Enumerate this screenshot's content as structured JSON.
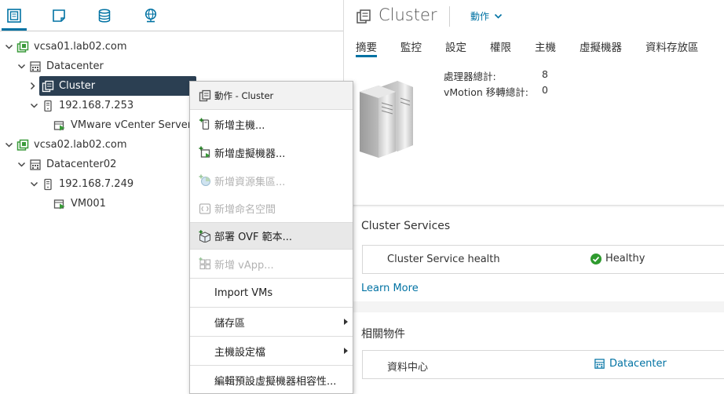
{
  "colors": {
    "accent": "#0072a3",
    "selected_bg": "#2b3f52",
    "ok_green": "#2e9a2e",
    "host_green": "#2f8d2f"
  },
  "nav_tabs": [
    {
      "icon": "hosts-clusters-icon"
    },
    {
      "icon": "vms-templates-icon"
    },
    {
      "icon": "storage-icon"
    },
    {
      "icon": "network-icon"
    }
  ],
  "tree": [
    {
      "label": "vcsa01.lab02.com",
      "icon": "vcenter-icon"
    },
    {
      "label": "Datacenter",
      "icon": "datacenter-icon"
    },
    {
      "label": "Cluster",
      "icon": "cluster-icon"
    },
    {
      "label": "192.168.7.253",
      "icon": "host-icon"
    },
    {
      "label": "VMware vCenter Server",
      "icon": "vm-icon"
    },
    {
      "label": "vcsa02.lab02.com",
      "icon": "vcenter-icon"
    },
    {
      "label": "Datacenter02",
      "icon": "datacenter-icon"
    },
    {
      "label": "192.168.7.249",
      "icon": "host-icon"
    },
    {
      "label": "VM001",
      "icon": "vm-icon"
    }
  ],
  "header": {
    "title": "Cluster",
    "actions_label": "動作",
    "tabs": [
      "摘要",
      "監控",
      "設定",
      "權限",
      "主機",
      "虛擬機器",
      "資料存放區"
    ]
  },
  "summary": {
    "rows": [
      {
        "key": "處理器總計:",
        "value": "8"
      },
      {
        "key": "vMotion 移轉總計:",
        "value": "0"
      }
    ]
  },
  "services": {
    "title": "Cluster Services",
    "health_label": "Cluster Service health",
    "health_value": "Healthy",
    "learn_more": "Learn More"
  },
  "related": {
    "title": "相關物件",
    "row_label": "資料中心",
    "row_value": "Datacenter"
  },
  "context_menu": {
    "header": "動作 - Cluster",
    "items": [
      {
        "label": "新增主機...",
        "icon": "add-host-icon",
        "enabled": true
      },
      {
        "label": "新增虛擬機器...",
        "icon": "new-vm-icon",
        "enabled": true
      },
      {
        "label": "新增資源集區...",
        "icon": "resource-pool-icon",
        "enabled": false
      },
      {
        "label": "新增命名空間",
        "icon": "namespace-icon",
        "enabled": false
      },
      {
        "label": "部署 OVF 範本...",
        "icon": "deploy-ovf-icon",
        "enabled": true
      },
      {
        "label": "新增 vApp...",
        "icon": "vapp-icon",
        "enabled": false
      },
      {
        "label": "Import VMs",
        "enabled": true
      },
      {
        "label": "儲存區",
        "enabled": true
      },
      {
        "label": "主機設定檔",
        "enabled": true
      },
      {
        "label": "編輯預設虛擬機器相容性...",
        "enabled": true
      }
    ]
  }
}
